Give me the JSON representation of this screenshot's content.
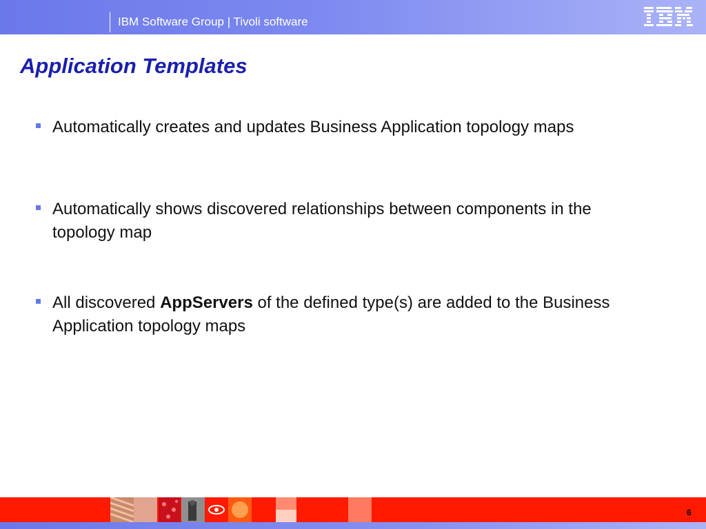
{
  "header": {
    "title": "IBM Software Group | Tivoli software",
    "logo_text": "IBM",
    "background_color": "#7d89f0"
  },
  "slide": {
    "title": "Application Templates",
    "title_color": "#1a1fae",
    "bullets": [
      {
        "text": "Automatically creates and updates Business Application topology maps"
      },
      {
        "text": "Automatically shows discovered relationships between components in the topology map"
      },
      {
        "text_before": "All discovered ",
        "bold": "AppServers",
        "text_after": " of the defined type(s) are added to the Business Application topology maps"
      }
    ],
    "bullet_color": "#6678e8"
  },
  "footer": {
    "page_number": "6",
    "band_color": "#ff1a00"
  }
}
